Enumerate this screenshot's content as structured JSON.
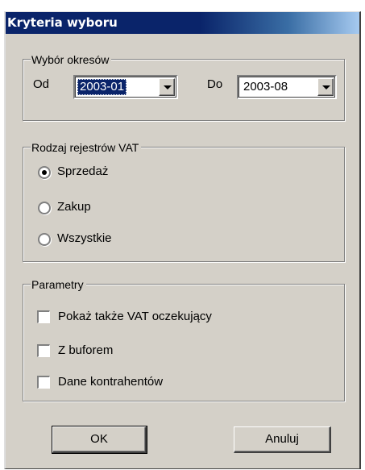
{
  "window": {
    "title": "Kryteria wyboru"
  },
  "periods": {
    "legend": "Wybór okresów",
    "from_label": "Od",
    "from_value": "2003-01",
    "to_label": "Do",
    "to_value": "2003-08"
  },
  "vat_registers": {
    "legend": "Rodzaj rejestrów VAT",
    "options": [
      {
        "label": "Sprzedaż",
        "checked": true
      },
      {
        "label": "Zakup",
        "checked": false
      },
      {
        "label": "Wszystkie",
        "checked": false
      }
    ]
  },
  "parameters": {
    "legend": "Parametry",
    "options": [
      {
        "label": "Pokaż także VAT oczekujący",
        "checked": false
      },
      {
        "label": "Z buforem",
        "checked": false
      },
      {
        "label": "Dane kontrahentów",
        "checked": false
      }
    ]
  },
  "buttons": {
    "ok": "OK",
    "cancel": "Anuluj"
  },
  "colors": {
    "dialog_bg": "#d4d0c8",
    "title_bar": "#0a246a",
    "selection": "#0a246a"
  }
}
